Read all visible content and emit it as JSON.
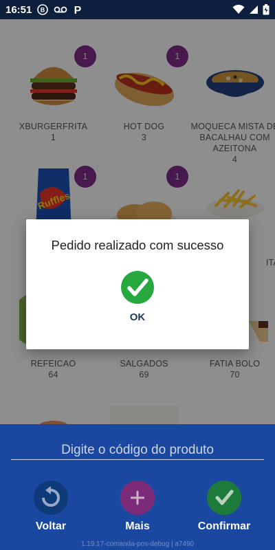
{
  "status_bar": {
    "time": "16:51"
  },
  "products": [
    {
      "name": "XBURGERFRITA",
      "code": "1",
      "badge": "1",
      "icon": "burger-icon"
    },
    {
      "name": "HOT DOG",
      "code": "3",
      "badge": "1",
      "icon": "hotdog-icon"
    },
    {
      "name": "MOQUECA MISTA DE BACALHAU COM AZEITONA",
      "code": "4",
      "badge": "",
      "icon": "stew-bowl-icon"
    },
    {
      "name": "",
      "code": "",
      "badge": "1",
      "icon": "chips-bag-icon"
    },
    {
      "name": "",
      "code": "",
      "badge": "1",
      "icon": "pastry-icon"
    },
    {
      "name": "ITA",
      "code": "",
      "badge": "",
      "icon": "fries-icon"
    },
    {
      "name": "REFEICAO",
      "code": "64",
      "badge": "",
      "icon": "meal-icon"
    },
    {
      "name": "SALGADOS",
      "code": "69",
      "badge": "",
      "icon": "snacks-icon"
    },
    {
      "name": "FATIA BOLO",
      "code": "70",
      "badge": "",
      "icon": "cake-icon"
    }
  ],
  "dialog": {
    "message": "Pedido realizado com sucesso",
    "ok_label": "OK",
    "icon": "check-circle-icon"
  },
  "bottom": {
    "code_placeholder": "Digite o código do produto",
    "back_label": "Voltar",
    "more_label": "Mais",
    "confirm_label": "Confirmar",
    "version": "1.19.17-comanda-pos-debug | a7490"
  },
  "colors": {
    "status_bar": "#0c1f3d",
    "panel": "#1a47a0",
    "badge": "#7a2a82",
    "success_green": "#27a83f",
    "back_button": "#0f3a7a",
    "more_button": "#7d2a78",
    "confirm_button": "#1e7a3a"
  }
}
